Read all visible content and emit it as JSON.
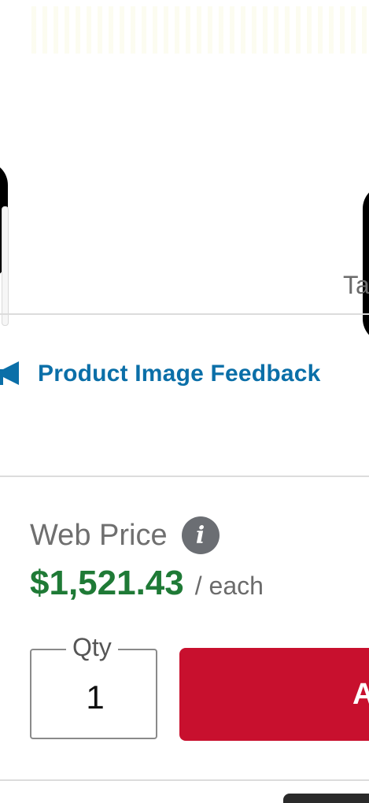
{
  "gallery": {
    "tab_peek_text": "Ta"
  },
  "feedback": {
    "icon": "megaphone-icon",
    "label": "Product Image Feedback",
    "color": "#0b6fa8"
  },
  "pricing": {
    "heading": "Web Price",
    "info_icon_glyph": "i",
    "amount": "$1,521.43",
    "unit": "/ each",
    "amount_color": "#1f7a36"
  },
  "quantity": {
    "legend": "Qty",
    "value": "1"
  },
  "add_button": {
    "label": "A",
    "color": "#c8102e"
  }
}
